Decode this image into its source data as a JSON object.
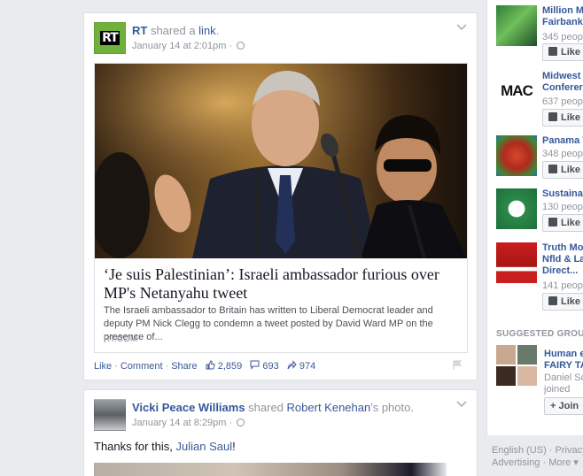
{
  "story1": {
    "actor": "RT",
    "verb": " shared a ",
    "object": "link",
    "after": ".",
    "timestamp": "January 14 at 2:01pm",
    "time_sep": " · ",
    "avatar_text": "RT",
    "share": {
      "title": "‘Je suis Palestinian’: Israeli ambassador furious over MP's Netanyahu tweet",
      "description": "The Israeli ambassador to Britain has written to Liberal Democrat leader and deputy PM Nick Clegg to condemn a tweet posted by David Ward MP on the presence of...",
      "domain": "RT.COM"
    },
    "actions": {
      "like": "Like",
      "comment": "Comment",
      "share": "Share",
      "sep": "·",
      "likes_count": "2,859",
      "comments_count": "693",
      "shares_count": "974"
    }
  },
  "story2": {
    "actor": "Vicki Peace Williams",
    "verb": " shared ",
    "object": "Robert Kenehan",
    "after": "'s photo.",
    "timestamp": "January 14 at 8:29pm",
    "time_sep": " · ",
    "text_prefix": "Thanks for this, ",
    "text_mention": "Julian Saul",
    "text_suffix": "!"
  },
  "sidebar": {
    "pages": [
      {
        "name1": "Million M",
        "name2": "Fairbank",
        "name3": "",
        "likes": "345 people",
        "like_label": "Like"
      },
      {
        "name1": "Midwest",
        "name2": "Conferer",
        "name3": "",
        "likes": "637 people",
        "like_label": "Like"
      },
      {
        "name1": "Panama V",
        "name2": "",
        "name3": "",
        "likes": "348 people",
        "like_label": "Like"
      },
      {
        "name1": "Sustaina",
        "name2": "",
        "name3": "",
        "likes": "130 people",
        "like_label": "Like"
      },
      {
        "name1": "Truth Mo",
        "name2": "Nfld & La",
        "name3": "Direct...",
        "likes": "141 people",
        "like_label": "Like"
      }
    ],
    "mac_logo": "MAC",
    "suggested_heading": "SUGGESTED GROUPS",
    "group": {
      "name1": "Human e",
      "name2": "FAIRY TA",
      "meta1": "Daniel Sc",
      "meta2": "joined",
      "join_label": "+ Join"
    }
  },
  "footer": {
    "line1": "English (US) · Privacy",
    "line2": "Advertising · More ▾"
  },
  "colors": {
    "link": "#365899",
    "muted": "#90949c",
    "rt_green": "#6fb13a"
  }
}
